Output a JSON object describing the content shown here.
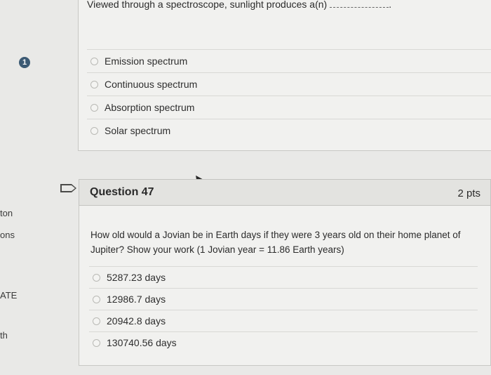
{
  "sidebar": {
    "fragments": [
      "ton",
      "ons",
      "ATE",
      "th"
    ]
  },
  "previous_question": {
    "number_badge": "1",
    "prompt": "Viewed through a spectroscope, sunlight produces a(n)",
    "prompt_suffix": ".",
    "options": [
      "Emission spectrum",
      "Continuous spectrum",
      "Absorption spectrum",
      "Solar spectrum"
    ]
  },
  "question": {
    "title": "Question 47",
    "points": "2 pts",
    "text": "How old would a Jovian be in Earth days if they were 3 years old on their home planet of Jupiter? Show your work (1 Jovian year = 11.86 Earth years)",
    "options": [
      "5287.23 days",
      "12986.7 days",
      "20942.8 days",
      "130740.56 days"
    ]
  },
  "icons": {
    "flag": "flag-icon",
    "badge": "number-badge"
  },
  "colors": {
    "background": "#e9e9e7",
    "panel": "#f1f1ef",
    "header": "#e3e3e0",
    "badge": "#3c5a74"
  }
}
